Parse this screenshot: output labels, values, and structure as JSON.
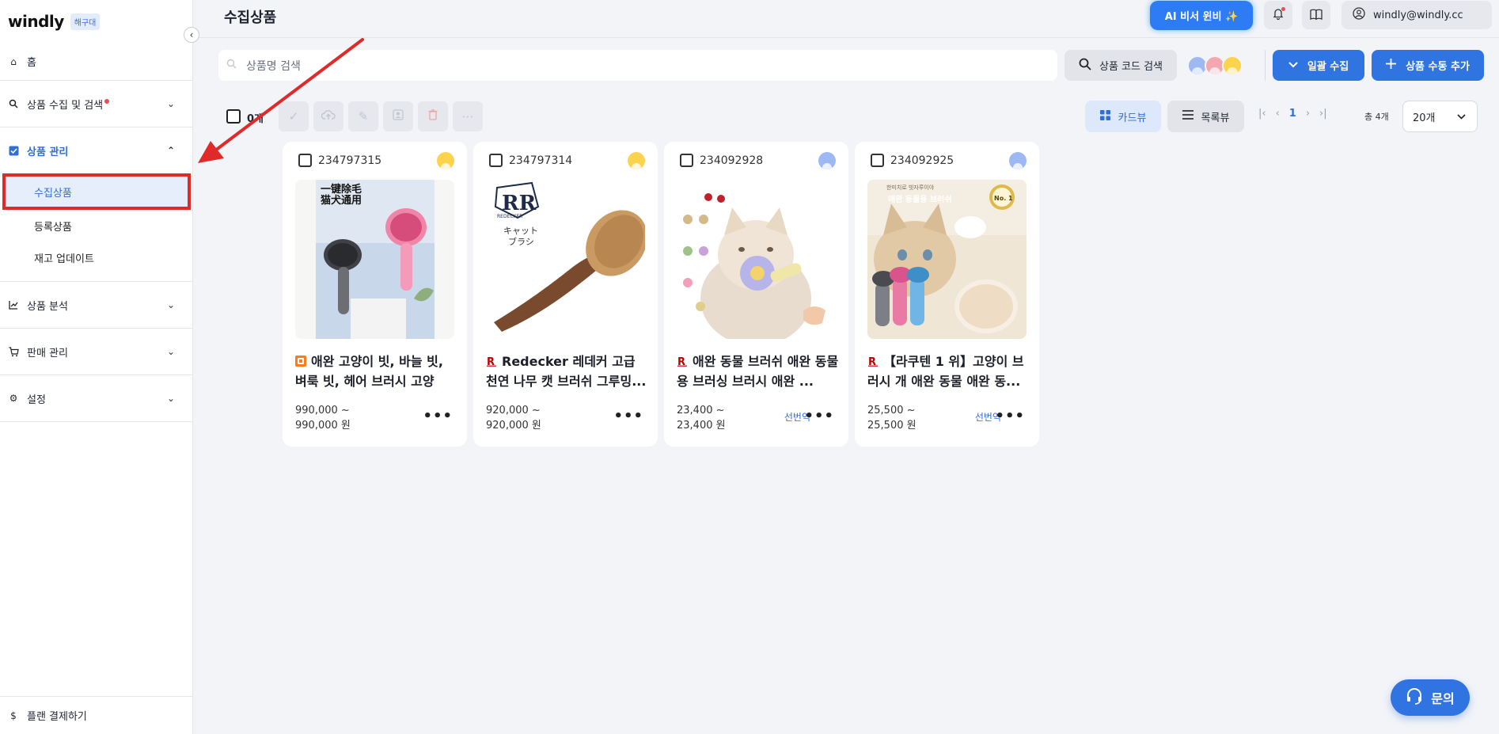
{
  "sidebar": {
    "logo": "windly",
    "logo_badge": "해구대",
    "home": "홈",
    "groups": [
      {
        "label": "상품 수집 및 검색",
        "expanded": false,
        "has_dot": true
      },
      {
        "label": "상품 관리",
        "expanded": true,
        "items": [
          "수집상품",
          "등록상품",
          "재고 업데이트"
        ]
      },
      {
        "label": "상품 분석",
        "expanded": false
      },
      {
        "label": "판매 관리",
        "expanded": false
      },
      {
        "label": "설정",
        "expanded": false
      }
    ],
    "plan": "플랜 결제하기"
  },
  "header": {
    "title": "수집상품",
    "ai_button": "AI 비서 윈비 ✨",
    "user_email": "windly@windly.cc"
  },
  "search": {
    "placeholder": "상품명 검색",
    "code_search": "상품 코드 검색",
    "bulk_collect": "일괄 수집",
    "manual_add": "상품 수동 추가"
  },
  "toolbar": {
    "selected_count": "0개",
    "card_view": "카드뷰",
    "list_view": "목록뷰",
    "current_page": "1",
    "total": "총 4개",
    "per_page": "20개"
  },
  "products": [
    {
      "id": "234797315",
      "title": "애완 고양이 빗, 바늘 빗, 벼룩 빗, 헤어 브러시 고양이...",
      "price_min": "990,000 ~",
      "price_max": "990,000 원",
      "translate": "",
      "market": "taobao",
      "owner_color": "#fcd34d"
    },
    {
      "id": "234797314",
      "title": "Redecker 레데커 고급 천연 나무 캣 브러쉬 그루밍...",
      "price_min": "920,000 ~",
      "price_max": "920,000 원",
      "translate": "",
      "market": "rakuten",
      "owner_color": "#fcd34d"
    },
    {
      "id": "234092928",
      "title": "애완 동물 브러쉬 애완 동물 용 브러싱 브러시 애완 ...",
      "price_min": "23,400 ~",
      "price_max": "23,400 원",
      "translate": "선번역",
      "market": "rakuten",
      "owner_color": "#9db8f2"
    },
    {
      "id": "234092925",
      "title": "【라쿠텐 1 위】고양이 브러시 개 애완 동물 애완 동...",
      "price_min": "25,500 ~",
      "price_max": "25,500 원",
      "translate": "선번역",
      "market": "rakuten",
      "owner_color": "#9db8f2"
    }
  ],
  "image_text": {
    "card1_line1": "一键除毛",
    "card1_line2": "猫犬通用",
    "card2_brand": "REDECKER",
    "card2_line1": "キャット",
    "card2_line2": "ブラシ",
    "card4_line1": "한미치로 빗자루이야",
    "card4_line2": "애완 동물용 브러쉬",
    "card4_badge": "No. 1"
  },
  "help": {
    "label": "문의"
  },
  "colors": {
    "accent": "#2f74e0",
    "highlight": "#e02a2a"
  }
}
